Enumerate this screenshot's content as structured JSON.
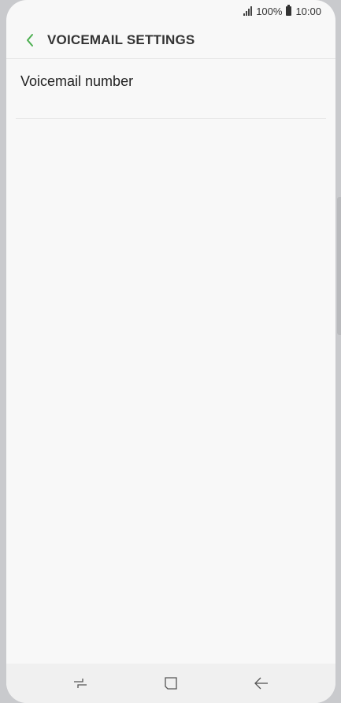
{
  "status_bar": {
    "battery_percent": "100%",
    "time": "10:00"
  },
  "app_bar": {
    "title": "VOICEMAIL SETTINGS",
    "back_icon": "chevron-left-icon"
  },
  "list": {
    "items": [
      {
        "label": "Voicemail number"
      }
    ]
  },
  "nav_bar": {
    "recents_icon": "recents-icon",
    "home_icon": "home-icon",
    "back_icon": "back-arrow-icon"
  },
  "colors": {
    "accent": "#4caf50",
    "background": "#f8f8f8",
    "text": "#222222",
    "frame": "#c9cacd"
  }
}
